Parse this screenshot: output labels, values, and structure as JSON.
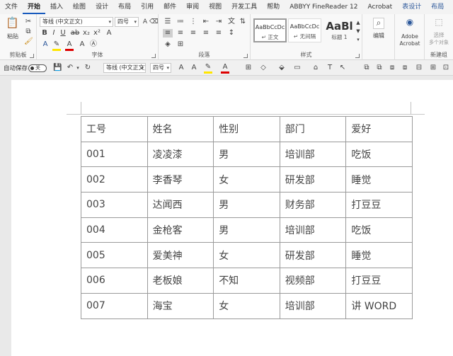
{
  "tabs": [
    "文件",
    "开始",
    "插入",
    "绘图",
    "设计",
    "布局",
    "引用",
    "邮件",
    "审阅",
    "视图",
    "开发工具",
    "帮助",
    "ABBYY FineReader 12",
    "Acrobat",
    "表设计",
    "布局"
  ],
  "active_tab": "开始",
  "ribbon": {
    "clipboard": {
      "label": "剪贴板",
      "paste_label": "粘贴"
    },
    "font": {
      "label": "字体",
      "font_name": "等线 (中文正文)",
      "font_size": "四号"
    },
    "paragraph": {
      "label": "段落"
    },
    "styles": {
      "label": "样式",
      "items": [
        {
          "sample": "AaBbCcDc",
          "name": "↵ 正文"
        },
        {
          "sample": "AaBbCcDc",
          "name": "↵ 无间隔"
        },
        {
          "sample": "AaBl",
          "name": "标题 1"
        }
      ]
    },
    "editing": {
      "label": "编辑"
    },
    "acrobat": {
      "label_line1": "Adobe",
      "label_line2": "Acrobat"
    },
    "select": {
      "label_line1": "选择",
      "label_line2": "多个对象"
    },
    "new_group": {
      "label": "新建组"
    }
  },
  "qat": {
    "autosave_label": "自动保存",
    "toggle_state": "关",
    "font_name": "等线 (中文正文)",
    "font_size": "四号"
  },
  "table": {
    "rows": [
      [
        "工号",
        "姓名",
        "性别",
        "部门",
        "爱好"
      ],
      [
        "001",
        "凌凌漆",
        "男",
        "培训部",
        "吃饭"
      ],
      [
        "002",
        "李香琴",
        "女",
        "研发部",
        "睡觉"
      ],
      [
        "003",
        "达闻西",
        "男",
        "财务部",
        "打豆豆"
      ],
      [
        "004",
        "金枪客",
        "男",
        "培训部",
        "吃饭"
      ],
      [
        "005",
        "爱美神",
        "女",
        "研发部",
        "睡觉"
      ],
      [
        "006",
        "老板娘",
        "不知",
        "视频部",
        "打豆豆"
      ],
      [
        "007",
        "海宝",
        "女",
        "培训部",
        "讲 WORD"
      ]
    ]
  }
}
